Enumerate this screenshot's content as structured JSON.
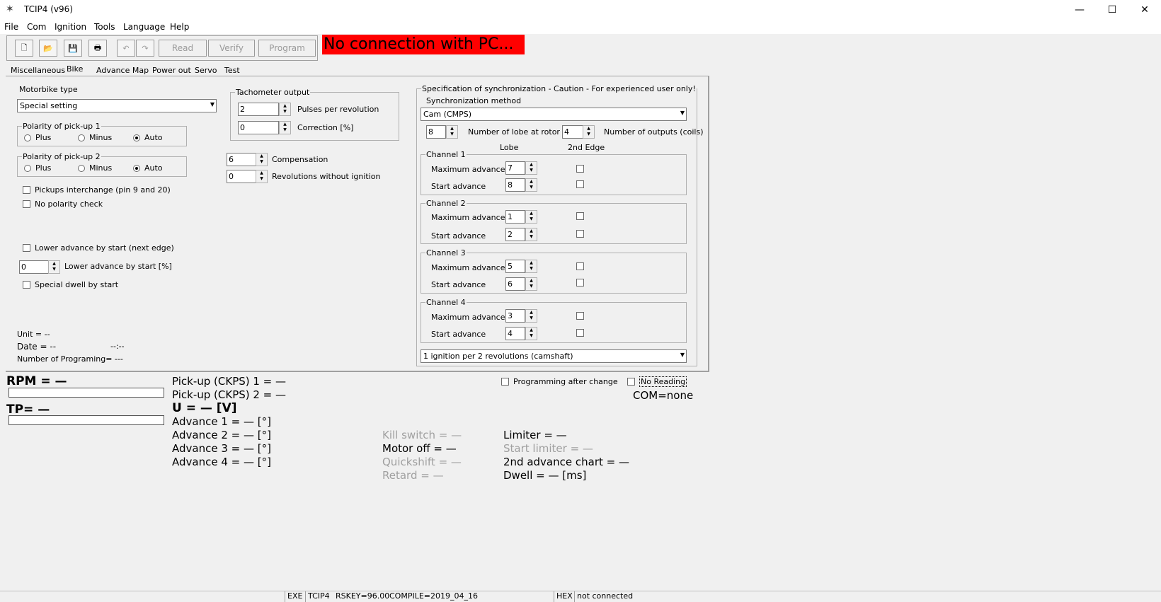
{
  "window": {
    "title": "TCIP4 (v96)",
    "minimize": "—",
    "maximize": "☐",
    "close": "✕"
  },
  "menu": [
    "File",
    "Com",
    "Ignition",
    "Tools",
    "Language",
    "Help"
  ],
  "toolbar": {
    "icons": [
      "new-icon",
      "open-icon",
      "save-icon",
      "print-icon",
      "undo-icon",
      "redo-icon"
    ],
    "read": "Read",
    "verify": "Verify",
    "program": "Program"
  },
  "banner": "No connection with PC...",
  "tabs": [
    "Miscellaneous",
    "Bike",
    "Advance Map",
    "Power out",
    "Servo",
    "Test"
  ],
  "left": {
    "motorbike_type_label": "Motorbike type",
    "motorbike_type_value": "Special setting",
    "polarity1": {
      "label": "Polarity of pick-up 1",
      "plus": "Plus",
      "minus": "Minus",
      "auto": "Auto",
      "selected": "Auto"
    },
    "polarity2": {
      "label": "Polarity of pick-up 2",
      "plus": "Plus",
      "minus": "Minus",
      "auto": "Auto",
      "selected": "Auto"
    },
    "pickups_interchange": "Pickups interchange (pin 9 and 20)",
    "no_polarity_check": "No polarity check",
    "lower_advance_next_edge": "Lower advance by start (next edge)",
    "lower_advance_value": "0",
    "lower_advance_pct": "Lower advance by start [%]",
    "special_dwell": "Special dwell by start",
    "unit": "Unit = --",
    "date": "Date = --",
    "time": "--:--",
    "num_programing": "Number of Programing= ---"
  },
  "tacho": {
    "label": "Tachometer output",
    "pulses_value": "2",
    "pulses_label": "Pulses per revolution",
    "correction_value": "0",
    "correction_label": "Correction [%]",
    "compensation_value": "6",
    "compensation_label": "Compensation",
    "rev_without_value": "0",
    "rev_without_label": "Revolutions without ignition"
  },
  "sync": {
    "label": "Specification of synchronization - Caution - For experienced user only!",
    "method_label": "Synchronization method",
    "method_value": "Cam (CMPS)",
    "lobe_value": "8",
    "lobe_label": "Number of lobe at rotor",
    "outputs_value": "4",
    "outputs_label": "Number of outputs (coils)",
    "col_lobe": "Lobe",
    "col_2nd_edge": "2nd Edge",
    "channels": [
      {
        "name": "Channel 1",
        "max_label": "Maximum advance",
        "max": "7",
        "start_label": "Start advance",
        "start": "8"
      },
      {
        "name": "Channel 2",
        "max_label": "Maximum advance",
        "max": "1",
        "start_label": "Start advance",
        "start": "2"
      },
      {
        "name": "Channel 3",
        "max_label": "Maximum advance",
        "max": "5",
        "start_label": "Start advance",
        "start": "6"
      },
      {
        "name": "Channel 4",
        "max_label": "Maximum advance",
        "max": "3",
        "start_label": "Start advance",
        "start": "4"
      }
    ],
    "ignition_mode": "1 ignition per 2 revolutions (camshaft)"
  },
  "monitor": {
    "rpm": "RPM = —",
    "tp": "TP= —",
    "pickup1": "Pick-up (CKPS) 1 = —",
    "pickup2": "Pick-up (CKPS) 2 = —",
    "voltage": "U = — [V]",
    "adv1": "Advance 1 = — [°]",
    "adv2": "Advance 2 = — [°]",
    "adv3": "Advance 3 = — [°]",
    "adv4": "Advance 4 = — [°]",
    "kill_switch": "Kill switch = —",
    "motor_off": "Motor off = —",
    "quickshift": "Quickshift = —",
    "retard": "Retard = —",
    "limiter": "Limiter = —",
    "start_limiter": "Start limiter = —",
    "second_chart": "2nd advance chart = —",
    "dwell": "Dwell = — [ms]",
    "programming_after_change": "Programming after change",
    "no_reading": "No Reading",
    "com": "COM=none"
  },
  "status": {
    "exe": "EXE",
    "name": "TCIP4",
    "rskey": "RSKEY=96.00",
    "compile": "COMPILE=2019_04_16",
    "hex": "HEX",
    "conn": "not connected"
  }
}
